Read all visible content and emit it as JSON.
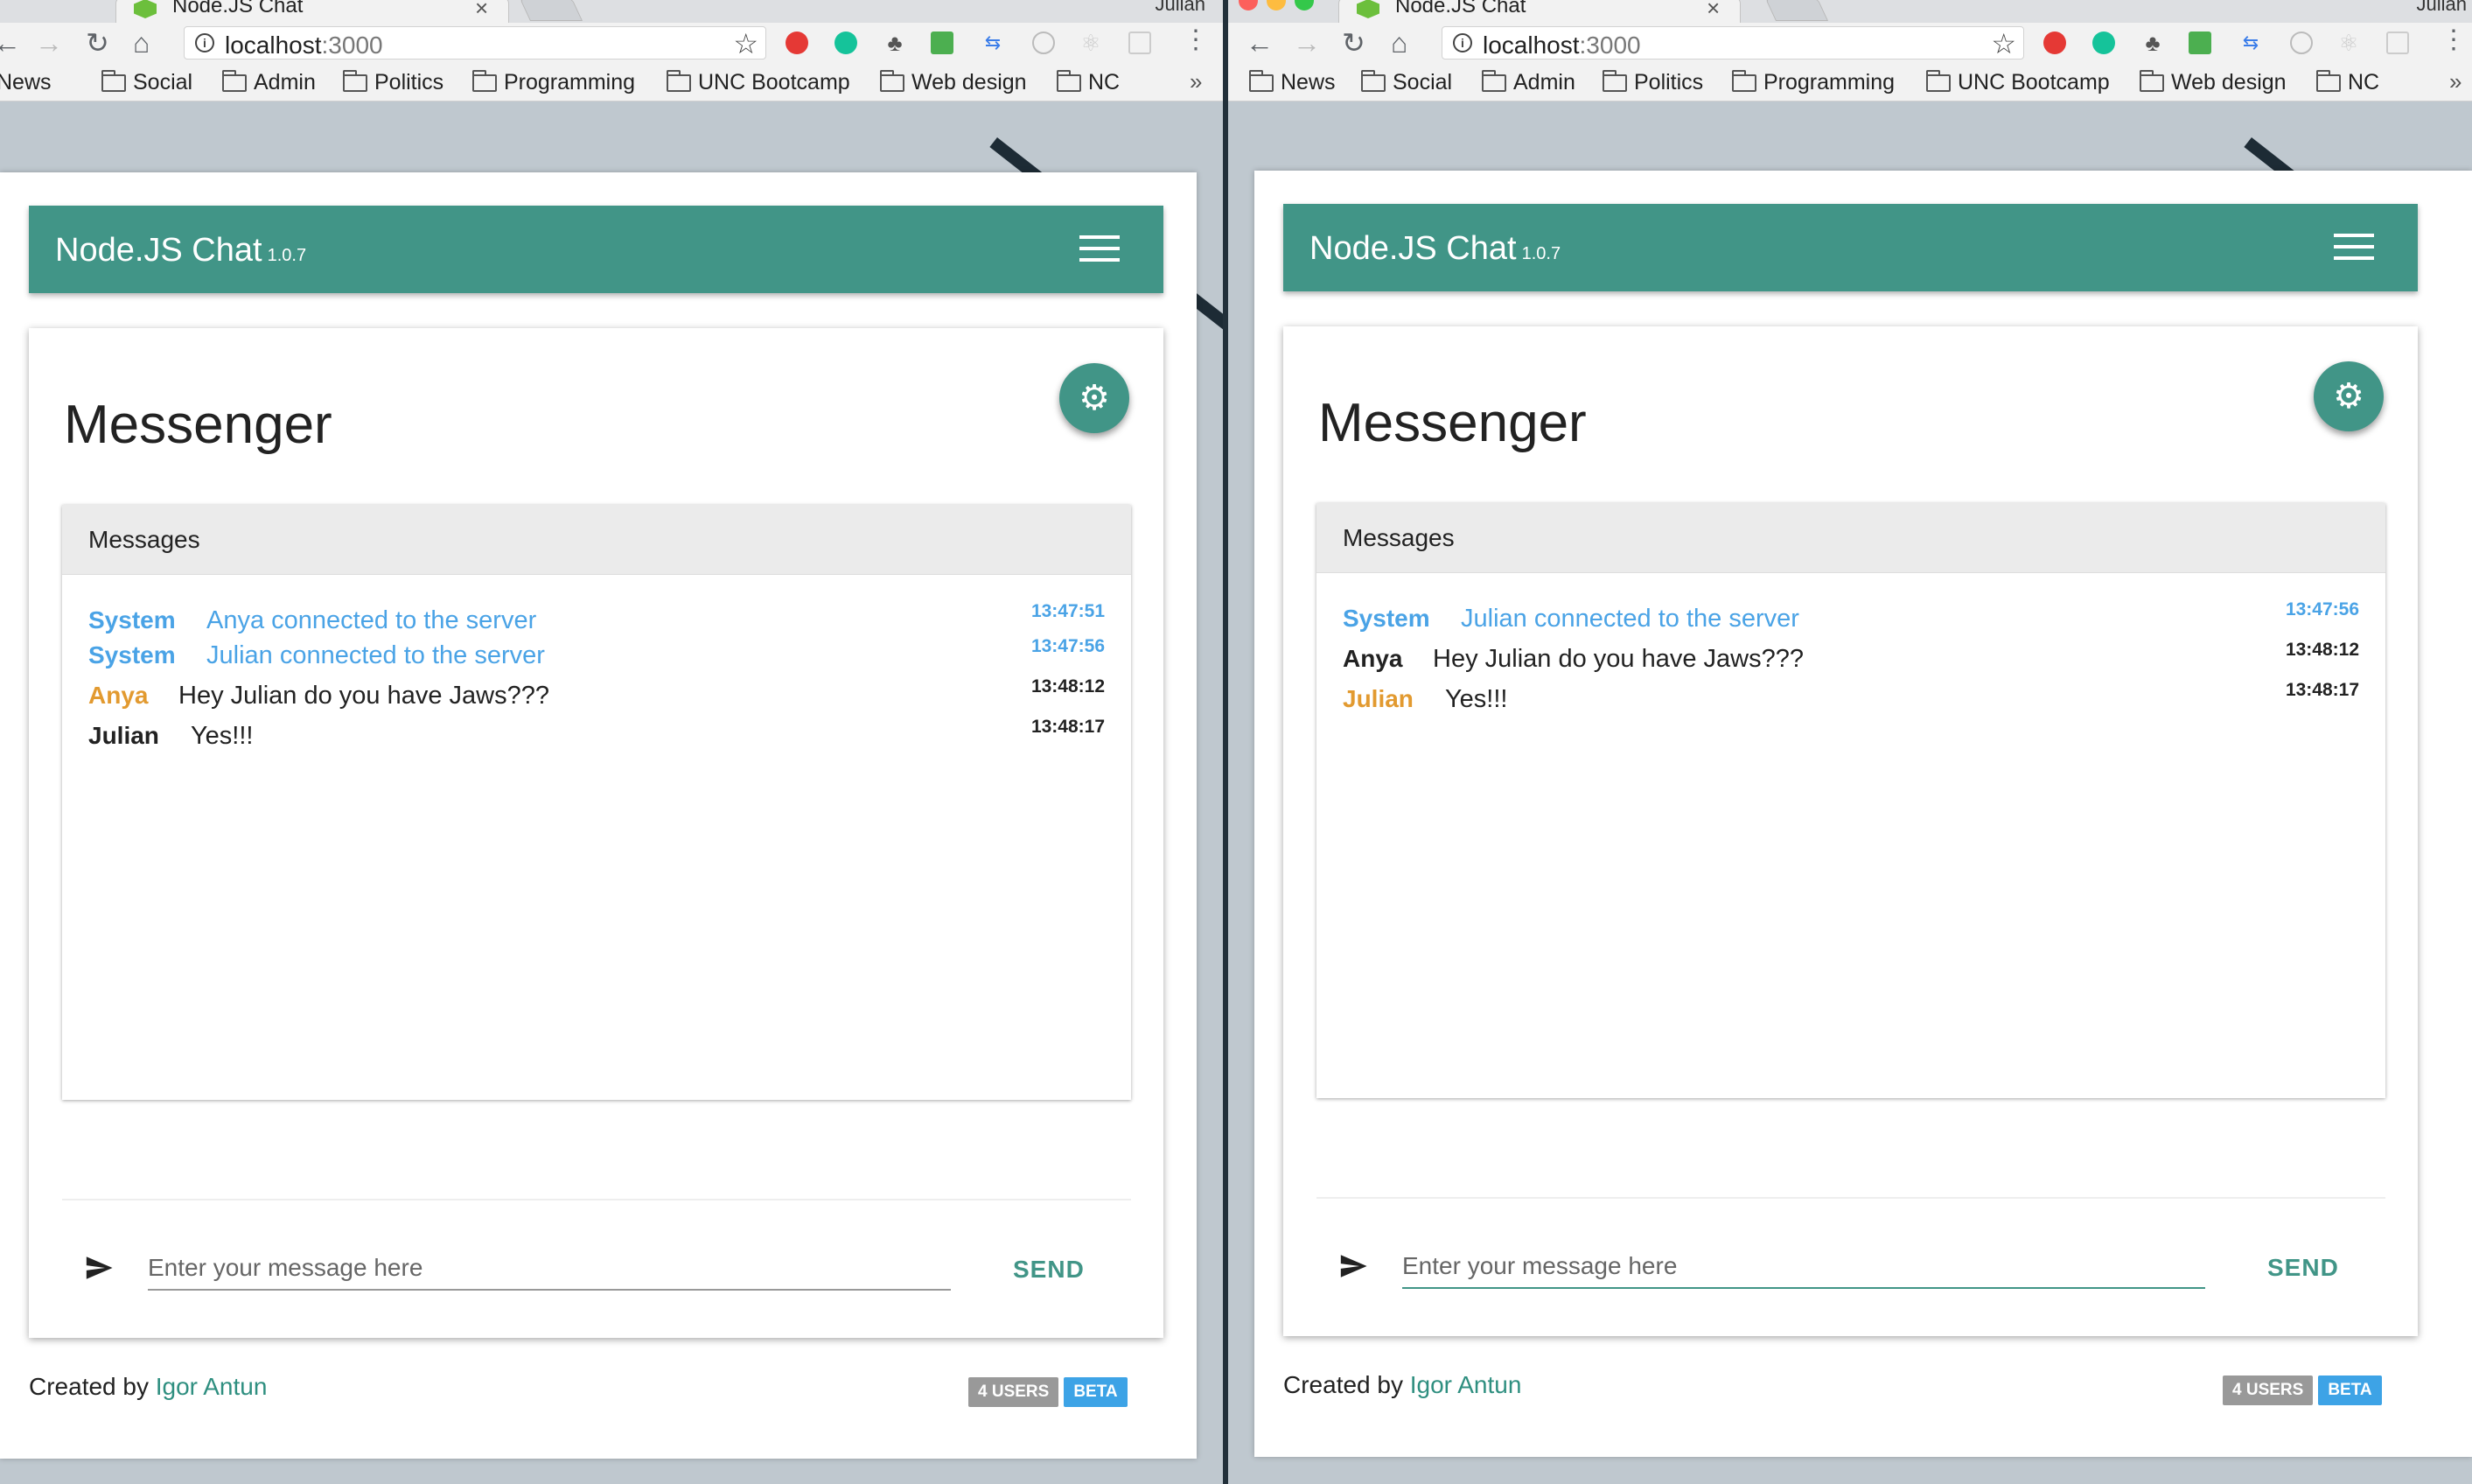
{
  "left": {
    "tab_title": "Node.JS Chat",
    "tab_close": "×",
    "profile_name": "Julian",
    "url_host": "localhost",
    "url_port": ":3000",
    "bookmarks": [
      "News",
      "Social",
      "Admin",
      "Politics",
      "Programming",
      "UNC Bootcamp",
      "Web design",
      "NC"
    ],
    "bookmarks_overflow": "»",
    "brand": "Node.JS Chat",
    "version": "1.0.7",
    "page_title": "Messenger",
    "messages_header": "Messages",
    "messages": [
      {
        "author": "System",
        "text": "Anya connected to the server",
        "time": "13:47:51"
      },
      {
        "author": "System",
        "text": "Julian connected to the server",
        "time": "13:47:56"
      },
      {
        "author": "Anya",
        "text": "Hey Julian do you have Jaws???",
        "time": "13:48:12"
      },
      {
        "author": "Julian",
        "text": "Yes!!!",
        "time": "13:48:17"
      }
    ],
    "input_placeholder": "Enter your message here",
    "send_label": "SEND",
    "footer_prefix": "Created by",
    "footer_author": "Igor Antun",
    "users_badge": "4 USERS",
    "beta_badge": "BETA"
  },
  "right": {
    "tab_title": "Node.JS Chat",
    "tab_close": "×",
    "profile_name": "Julian",
    "url_host": "localhost",
    "url_port": ":3000",
    "bookmarks": [
      "News",
      "Social",
      "Admin",
      "Politics",
      "Programming",
      "UNC Bootcamp",
      "Web design",
      "NC"
    ],
    "bookmarks_overflow": "»",
    "brand": "Node.JS Chat",
    "version": "1.0.7",
    "page_title": "Messenger",
    "messages_header": "Messages",
    "messages": [
      {
        "author": "System",
        "text": "Julian connected to the server",
        "time": "13:47:56"
      },
      {
        "author": "Anya",
        "text": "Hey Julian do you have Jaws???",
        "time": "13:48:12"
      },
      {
        "author": "Julian",
        "text": "Yes!!!",
        "time": "13:48:17"
      }
    ],
    "input_placeholder": "Enter your message here",
    "send_label": "SEND",
    "footer_prefix": "Created by",
    "footer_author": "Igor Antun",
    "users_badge": "4 USERS",
    "beta_badge": "BETA"
  },
  "colors": {
    "accent": "#419587",
    "system": "#4aa3e6",
    "highlight_user": "#e29a30",
    "badge_grey": "#999999",
    "badge_blue": "#3da3e6"
  },
  "icons": [
    "favicon-icon",
    "close-icon",
    "back-icon",
    "forward-icon",
    "reload-icon",
    "home-icon",
    "info-icon",
    "star-icon",
    "folder-icon",
    "menu-icon",
    "gear-icon",
    "send-icon"
  ]
}
